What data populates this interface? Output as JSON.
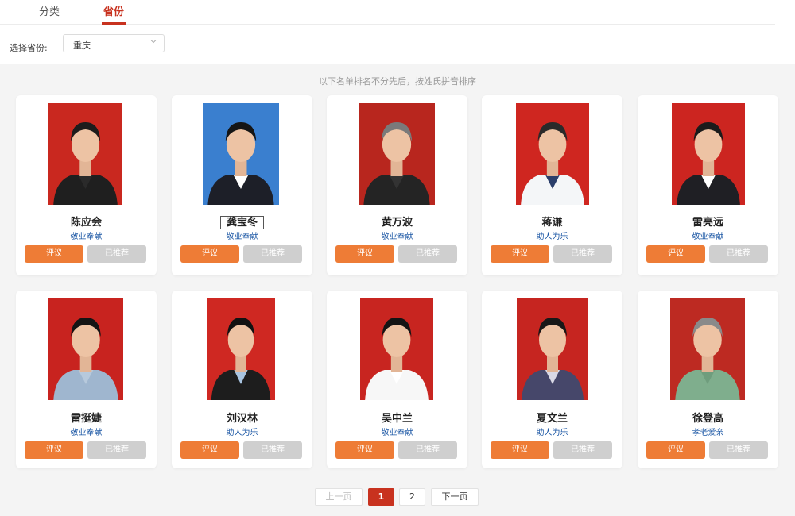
{
  "tabs": [
    "分类",
    "省份"
  ],
  "filter": {
    "label": "选择省份:",
    "selected": "重庆"
  },
  "note": "以下名单排名不分先后，按姓氏拼音排序",
  "buttons": {
    "rate": "评议",
    "recommended": "已推荐"
  },
  "people": [
    {
      "name": "陈应会",
      "category": "敬业奉献"
    },
    {
      "name": "龚宝冬",
      "category": "敬业奉献"
    },
    {
      "name": "黄万波",
      "category": "敬业奉献"
    },
    {
      "name": "蒋谦",
      "category": "助人为乐"
    },
    {
      "name": "雷亮远",
      "category": "敬业奉献"
    },
    {
      "name": "雷挺婕",
      "category": "敬业奉献"
    },
    {
      "name": "刘汉林",
      "category": "助人为乐"
    },
    {
      "name": "吴中兰",
      "category": "敬业奉献"
    },
    {
      "name": "夏文兰",
      "category": "助人为乐"
    },
    {
      "name": "徐登高",
      "category": "孝老爱亲"
    }
  ],
  "pagination": {
    "prev": "上一页",
    "pages": [
      "1",
      "2"
    ],
    "current": "1",
    "next": "下一页"
  },
  "colors": {
    "accent": "#c8321f",
    "rate_button": "#ee7c36",
    "recommended_button": "#cfcfcf",
    "category_text": "#1a56a4"
  }
}
